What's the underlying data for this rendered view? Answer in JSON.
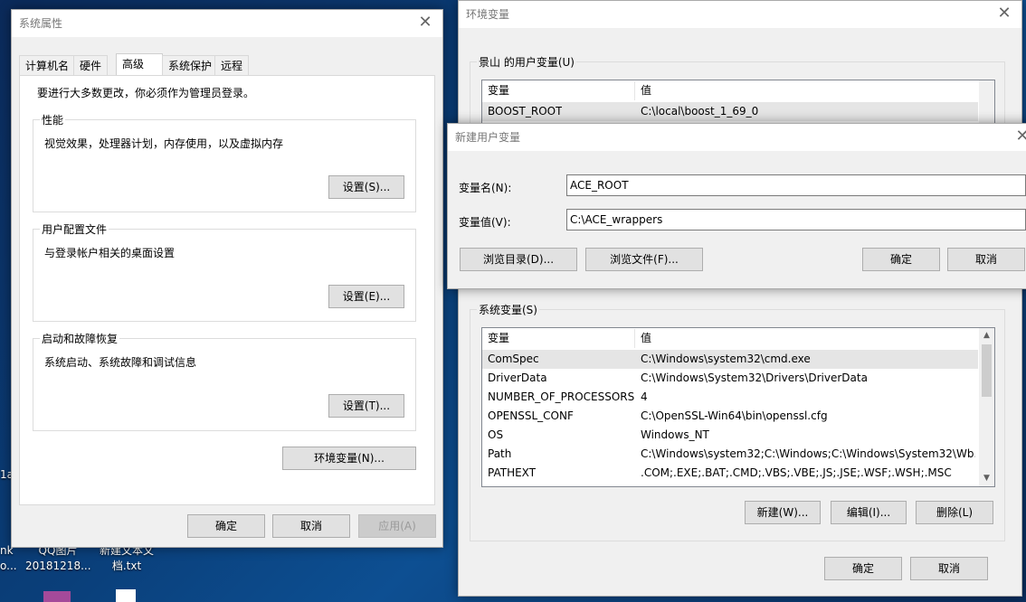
{
  "desktop": {
    "icon1_label": "1a",
    "icon2_label": "nk",
    "icon3_label": "o...",
    "qq_label1": "QQ图片",
    "qq_label2": "20181218...",
    "newtxt_label1": "新建文本文",
    "newtxt_label2": "档.txt"
  },
  "sys_props": {
    "title": "系统属性",
    "tabs": [
      "计算机名",
      "硬件",
      "高级",
      "系统保护",
      "远程"
    ],
    "admin_note": "要进行大多数更改，你必须作为管理员登录。",
    "perf_title": "性能",
    "perf_desc": "视觉效果，处理器计划，内存使用，以及虚拟内存",
    "perf_btn": "设置(S)...",
    "profile_title": "用户配置文件",
    "profile_desc": "与登录帐户相关的桌面设置",
    "profile_btn": "设置(E)...",
    "startup_title": "启动和故障恢复",
    "startup_desc": "系统启动、系统故障和调试信息",
    "startup_btn": "设置(T)...",
    "env_btn": "环境变量(N)...",
    "ok": "确定",
    "cancel": "取消",
    "apply": "应用(A)"
  },
  "env_vars": {
    "title": "环境变量",
    "user_group": "景山 的用户变量(U)",
    "col_var": "变量",
    "col_val": "值",
    "user_rows": [
      {
        "name": "BOOST_ROOT",
        "value": "C:\\local\\boost_1_69_0"
      }
    ],
    "sys_group": "系统变量(S)",
    "sys_rows": [
      {
        "name": "ComSpec",
        "value": "C:\\Windows\\system32\\cmd.exe"
      },
      {
        "name": "DriverData",
        "value": "C:\\Windows\\System32\\Drivers\\DriverData"
      },
      {
        "name": "NUMBER_OF_PROCESSORS",
        "value": "4"
      },
      {
        "name": "OPENSSL_CONF",
        "value": "C:\\OpenSSL-Win64\\bin\\openssl.cfg"
      },
      {
        "name": "OS",
        "value": "Windows_NT"
      },
      {
        "name": "Path",
        "value": "C:\\Windows\\system32;C:\\Windows;C:\\Windows\\System32\\Wb..."
      },
      {
        "name": "PATHEXT",
        "value": ".COM;.EXE;.BAT;.CMD;.VBS;.VBE;.JS;.JSE;.WSF;.WSH;.MSC"
      }
    ],
    "new_btn": "新建(W)...",
    "edit_btn": "编辑(I)...",
    "delete_btn": "删除(L)",
    "ok": "确定",
    "cancel": "取消"
  },
  "new_var": {
    "title": "新建用户变量",
    "name_label": "变量名(N):",
    "name_value": "ACE_ROOT",
    "value_label": "变量值(V):",
    "value_value": "C:\\ACE_wrappers",
    "browse_dir": "浏览目录(D)...",
    "browse_file": "浏览文件(F)...",
    "ok": "确定",
    "cancel": "取消"
  },
  "colors": {
    "selected_row": "#cce8ff",
    "row_highlight": "#e5f3ff"
  }
}
